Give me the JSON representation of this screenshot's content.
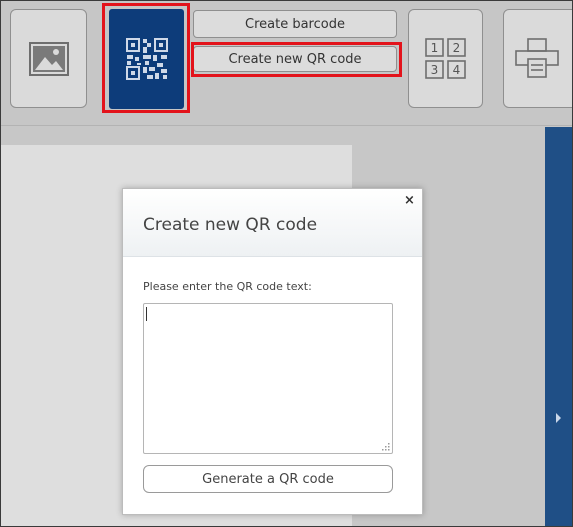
{
  "toolbar": {
    "image_tool": {
      "icon": "image-icon"
    },
    "qr_tool": {
      "icon": "qr-code-icon",
      "selected": true,
      "color": "#0d3c7a"
    },
    "create_barcode_label": "Create barcode",
    "create_qr_label": "Create new QR code",
    "layout_tool": {
      "icon": "numbered-grid-icon",
      "numbers": [
        "1",
        "2",
        "3",
        "4"
      ]
    },
    "print_tool": {
      "icon": "printer-icon"
    }
  },
  "highlight_color": "#e3131b",
  "dialog": {
    "title": "Create new QR code",
    "close_symbol": "×",
    "prompt": "Please enter the QR code text:",
    "text_value": "",
    "generate_label": "Generate a QR code"
  },
  "side_panel": {
    "icon": "expand-arrow-icon",
    "color": "#1f4f86"
  }
}
